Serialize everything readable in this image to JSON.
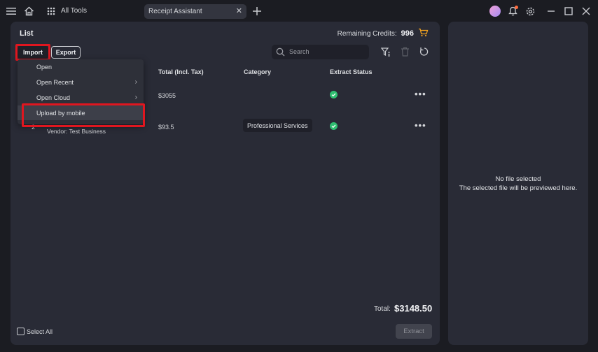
{
  "titlebar": {
    "all_tools_label": "All Tools",
    "tab_title": "Receipt Assistant",
    "tab_close": "✕",
    "new_tab": "+"
  },
  "list": {
    "title": "List",
    "credits_label": "Remaining Credits:",
    "credits_value": "996",
    "import_label": "Import",
    "export_label": "Export",
    "search_placeholder": "Search",
    "columns": {
      "total": "Total (Incl. Tax)",
      "category": "Category",
      "status": "Extract Status"
    },
    "rows": [
      {
        "index": "",
        "vendor": "",
        "total": "$3055",
        "category": ""
      },
      {
        "index": "2",
        "vendor": "Vendor: Test Business",
        "total": "$93.5",
        "category": "Professional Services"
      }
    ],
    "more_glyph": "•••",
    "total_label": "Total:",
    "total_value": "$3148.50",
    "select_all": "Select All",
    "extract_label": "Extract"
  },
  "import_menu": {
    "items": [
      {
        "label": "Open",
        "arrow": ""
      },
      {
        "label": "Open Recent",
        "arrow": "›"
      },
      {
        "label": "Open Cloud",
        "arrow": "›"
      },
      {
        "label": "Upload by mobile",
        "arrow": ""
      }
    ]
  },
  "preview": {
    "line1": "No file selected",
    "line2": "The selected file will be previewed here."
  },
  "colors": {
    "background": "#1b1c22",
    "panel": "#292b36",
    "highlight": "#e0161f",
    "success": "#2fbf71",
    "cart_accent": "#f0a020"
  },
  "icons": [
    "menu-icon",
    "home-icon",
    "grid-icon",
    "avatar",
    "bell-icon",
    "gear-icon",
    "minimize-icon",
    "maximize-icon",
    "close-icon",
    "cart-icon",
    "search-icon",
    "filter-icon",
    "trash-icon",
    "refresh-icon",
    "check-circle-icon"
  ]
}
